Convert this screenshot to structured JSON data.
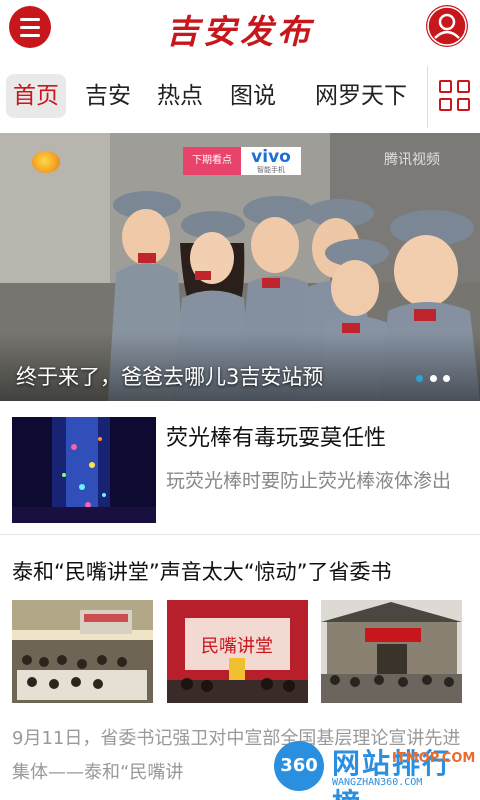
{
  "header": {
    "title": "吉安发布",
    "menu_icon": "menu-icon",
    "user_icon": "user-icon",
    "brand_color": "#c8161d"
  },
  "tabs": [
    {
      "label": "首页",
      "active": true
    },
    {
      "label": "吉安",
      "active": false
    },
    {
      "label": "热点",
      "active": false
    },
    {
      "label": "图说",
      "active": false
    },
    {
      "label": "网罗天下",
      "active": false
    }
  ],
  "tab_grid_icon": "grid-icon",
  "banner": {
    "caption": "终于来了，爸爸去哪儿3吉安站预",
    "ad_left": "下期看点",
    "ad_brand": "vivo",
    "ad_sub": "智能手机",
    "video_logo": "腾讯视频",
    "slide_count": 3,
    "active_slide": 0
  },
  "news": [
    {
      "title": "荧光棒有毒玩耍莫任性",
      "summary": "玩荧光棒时要防止荧光棒液体渗出"
    },
    {
      "title": "泰和“民嘴讲堂”声音太大“惊动”了省委书",
      "summary": "9月11日，省委书记强卫对中宣部全国基层理论宣讲先进集体——泰和“民嘴讲",
      "images": [
        "thumb-1",
        "thumb-2",
        "thumb-3"
      ],
      "thumb_banner": "民嘴讲堂"
    }
  ],
  "watermark": {
    "badge": "360",
    "name": "网站排行榜",
    "url": "WANGZHAN360.COM",
    "top_url": "ITMOP.COM"
  }
}
